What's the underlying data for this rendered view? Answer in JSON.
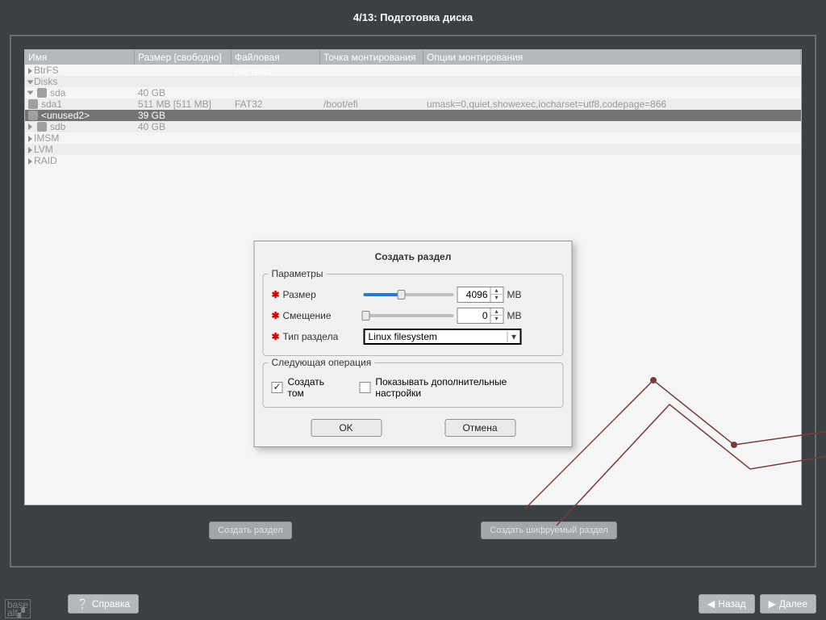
{
  "title": "4/13: Подготовка диска",
  "columns": {
    "name": "Имя",
    "size": "Размер [свободно]",
    "fs": "Файловая система",
    "mount": "Точка монтирования",
    "opts": "Опции монтирования"
  },
  "tree": {
    "btrfs": "BtrFS",
    "disks": "Disks",
    "sda": "sda",
    "sda_size": "40 GB",
    "sda1": "sda1",
    "sda1_size": "511 MB [511 MB]",
    "sda1_fs": "FAT32",
    "sda1_mnt": "/boot/efi",
    "sda1_opts": "umask=0,quiet,showexec,iocharset=utf8,codepage=866",
    "unused": "<unused2>",
    "unused_size": "39 GB",
    "sdb": "sdb",
    "sdb_size": "40 GB",
    "imsm": "IMSM",
    "lvm": "LVM",
    "raid": "RAID"
  },
  "toolbar": {
    "create": "Создать раздел",
    "create_enc": "Создать шифруемый раздел"
  },
  "dialog": {
    "title": "Создать раздел",
    "params_heading": "Параметры",
    "size_label": "Размер",
    "size_value": "4096",
    "unit": "MB",
    "offset_label": "Смещение",
    "offset_value": "0",
    "type_label": "Тип раздела",
    "type_value": "Linux filesystem",
    "next_heading": "Следующая операция",
    "create_vol": "Создать том",
    "show_adv": "Показывать дополнительные настройки",
    "ok": "OK",
    "cancel": "Отмена"
  },
  "footer": {
    "help": "Справка",
    "back": "Назад",
    "next": "Далее"
  }
}
